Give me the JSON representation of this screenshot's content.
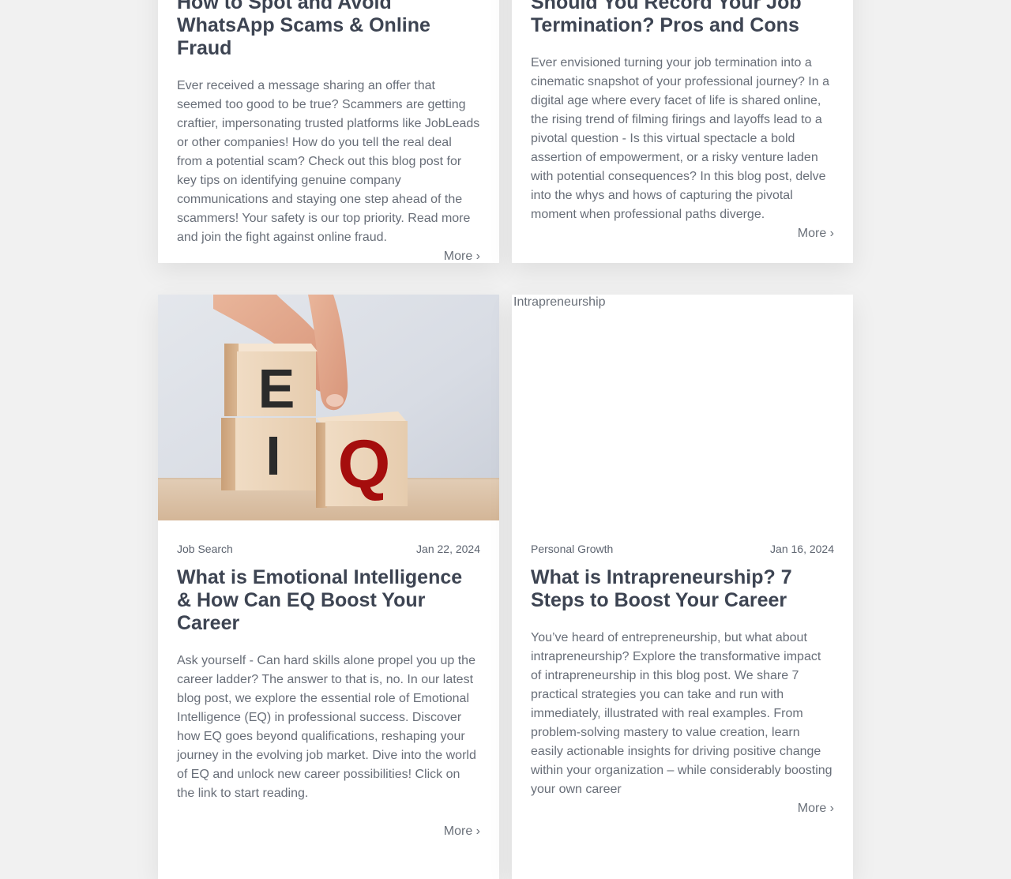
{
  "cards": [
    {
      "title": "How to Spot and Avoid WhatsApp Scams & Online Fraud",
      "excerpt": "Ever received a message sharing an offer that seemed too good to be true? Scammers are getting craftier, impersonating trusted platforms like JobLeads or other companies! How do you tell the real deal from a potential scam? Check out this blog post for key tips on identifying genuine company communications and staying one step ahead of the scammers! Your safety is our top priority. Read more and join the fight against online fraud.",
      "more": "More ›"
    },
    {
      "title": "Should You Record Your Job Termination? Pros and Cons",
      "excerpt": "Ever envisioned turning your job termination into a cinematic snapshot of your professional journey? In a digital age where every facet of life is shared online, the rising trend of filming firings and layoffs lead to a pivotal question - Is this virtual spectacle a bold assertion of empowerment, or a risky venture laden with potential consequences? In this blog post, delve into the whys and hows of capturing the pivotal moment when professional paths diverge.",
      "more": "More ›"
    },
    {
      "image_alt": "EQ",
      "image_letters": {
        "e": "E",
        "i": "I",
        "q": "Q"
      },
      "category": "Job Search",
      "date": "Jan 22, 2024",
      "title": "What is Emotional Intelligence & How Can EQ Boost Your Career",
      "excerpt": "Ask yourself - Can hard skills alone propel you up the career ladder? The answer to that is, no. In our latest blog post, we explore the essential role of Emotional Intelligence (EQ) in professional success. Discover how EQ goes beyond qualifications, reshaping your journey in the evolving job market. Dive into the world of EQ and unlock new career possibilities! Click on the link to start reading.",
      "more": "More ›"
    },
    {
      "image_alt": "Intrapreneurship",
      "category": "Personal Growth",
      "date": "Jan 16, 2024",
      "title": "What is Intrapreneurship? 7 Steps to Boost Your Career",
      "excerpt": "You’ve heard of entrepreneurship, but what about intrapreneurship? Explore the transformative impact of intrapreneurship in this blog post. We share 7 practical strategies you can take and run with immediately, illustrated with real examples. From problem-solving mastery to value creation, learn easily actionable insights for driving positive change within your organization – while considerably boosting your own career",
      "more": "More ›"
    }
  ],
  "colors": {
    "page_bg": "#f1f1f1",
    "card_bg": "#ffffff",
    "title": "#3d4452",
    "text": "#686e78",
    "accent_q": "#a50d0d"
  }
}
